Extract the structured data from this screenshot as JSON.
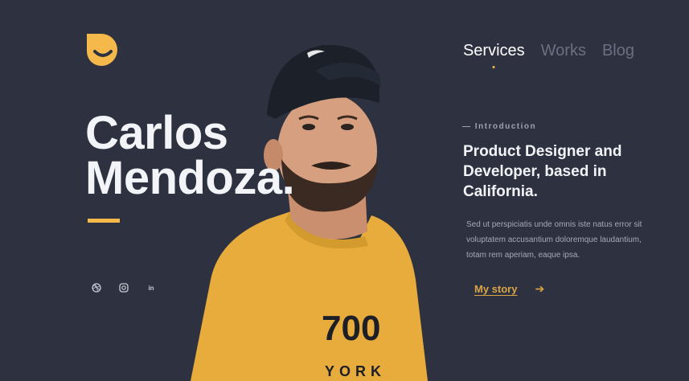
{
  "brand": {
    "logo_icon": "logo-mark-icon",
    "accent_color": "#f5b84a",
    "background_color": "#2e3140"
  },
  "nav": {
    "items": [
      {
        "label": "Services",
        "active": true
      },
      {
        "label": "Works",
        "active": false
      },
      {
        "label": "Blog",
        "active": false
      }
    ]
  },
  "hero": {
    "name_first": "Carlos",
    "name_last": "Mendoza."
  },
  "socials": [
    {
      "icon": "dribbble-icon"
    },
    {
      "icon": "instagram-icon"
    },
    {
      "icon": "linkedin-icon",
      "text": "in"
    }
  ],
  "intro": {
    "label": "— Introduction",
    "headline": "Product Designer and Developer, based in California.",
    "description": "Sed ut perspiciatis unde omnis iste natus error sit voluptatem accusantium doloremque laudantium, totam rem aperiam, eaque ipsa.",
    "cta_label": "My story",
    "cta_icon": "arrow-right-icon"
  },
  "portrait": {
    "shirt_text_top": "700",
    "shirt_text_bottom": "YORK",
    "shirt_color": "#e8ac3c",
    "cap_color": "#1c2029"
  }
}
